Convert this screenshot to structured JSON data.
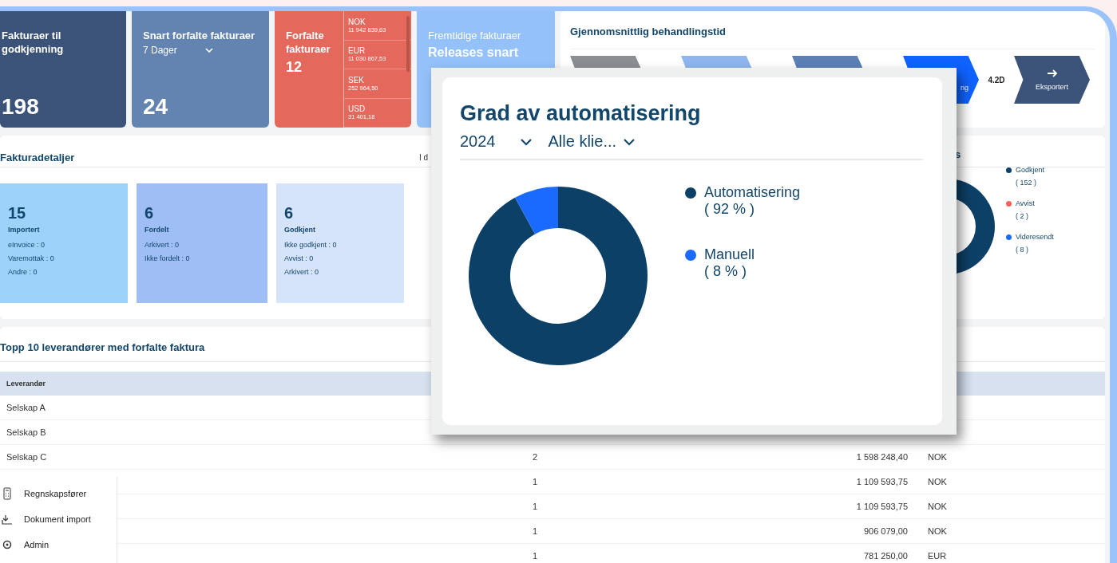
{
  "kpis": [
    {
      "kind": "count",
      "title": "Fakturaer til godkjenning",
      "value": "198"
    },
    {
      "kind": "filtered",
      "title": "Snart forfalte fakturaer",
      "filter": "7 Dager",
      "value": "24"
    },
    {
      "kind": "currency",
      "title": "Forfalte fakturaer",
      "value": "12",
      "currencies": [
        {
          "code": "NOK",
          "amount": "11 942 839,63"
        },
        {
          "code": "EUR",
          "amount": "11 030 867,53"
        },
        {
          "code": "SEK",
          "amount": "252 964,50"
        },
        {
          "code": "USD",
          "amount": "31 401,18"
        }
      ]
    },
    {
      "kind": "future",
      "title": "Fremtidige fakturaer",
      "subtitle": "Releases snart"
    }
  ],
  "processing": {
    "title": "Gjennomsnittlig behandlingstid",
    "steps": [
      {
        "kind": "import"
      },
      {
        "kind": "distribute"
      },
      {
        "kind": "approve"
      },
      {
        "kind": "review",
        "label": "ng"
      },
      {
        "kind": "export",
        "label": "Eksportert",
        "duration": "4.2D"
      }
    ]
  },
  "details": {
    "title": "Fakturadetaljer",
    "note": "I d",
    "cards": [
      {
        "value": "15",
        "label": "Importert",
        "lines": [
          "eInvoice : 0",
          "Varemottak : 0",
          "Andre : 0"
        ]
      },
      {
        "value": "6",
        "label": "Fordelt",
        "lines": [
          "Arkivert : 0",
          "Ikke fordelt : 0"
        ]
      },
      {
        "value": "6",
        "label": "Godkjent",
        "lines": [
          "Ikke godkjent : 0",
          "Avvist : 0",
          "Arkivert : 0"
        ]
      }
    ]
  },
  "status": {
    "title": "s",
    "legend": [
      {
        "label": "Godkjent",
        "count": "( 152 )",
        "color": "#0d4066"
      },
      {
        "label": "Avvist",
        "count": "( 2 )",
        "color": "#f0625a"
      },
      {
        "label": "Videresendt",
        "count": "( 8 )",
        "color": "#1a6aff"
      }
    ]
  },
  "table": {
    "title": "Topp 10 leverandører med forfalte faktura",
    "columns": [
      "Leverandør"
    ],
    "rows": [
      {
        "supplier": "Selskap A"
      },
      {
        "supplier": "Selskap B"
      },
      {
        "supplier": "Selskap C",
        "count": "2",
        "amount": "1 598 248,40",
        "currency": "NOK"
      },
      {
        "count": "1",
        "amount": "1 109 593,75",
        "currency": "NOK"
      },
      {
        "count": "1",
        "amount": "1 109 593,75",
        "currency": "NOK"
      },
      {
        "count": "1",
        "amount": "906 079,00",
        "currency": "NOK"
      },
      {
        "count": "1",
        "amount": "781 250,00",
        "currency": "EUR"
      }
    ]
  },
  "menu": {
    "items": [
      {
        "kind": "calculator",
        "label": "Regnskapsfører"
      },
      {
        "kind": "download",
        "label": "Dokument import"
      },
      {
        "kind": "settings",
        "label": "Admin"
      }
    ]
  },
  "popup": {
    "filters": [
      "2024",
      "Alle klie..."
    ],
    "legend": [
      {
        "percent": "( 92 % )",
        "color": "#0d4066"
      },
      {
        "percent": "( 8 % )",
        "color": "#1a6aff"
      }
    ],
    "chart_data": {
      "type": "donut",
      "title": "Grad av automatisering",
      "categories": [
        "Automatisering",
        "Manuell"
      ],
      "values": [
        92,
        8
      ]
    }
  }
}
